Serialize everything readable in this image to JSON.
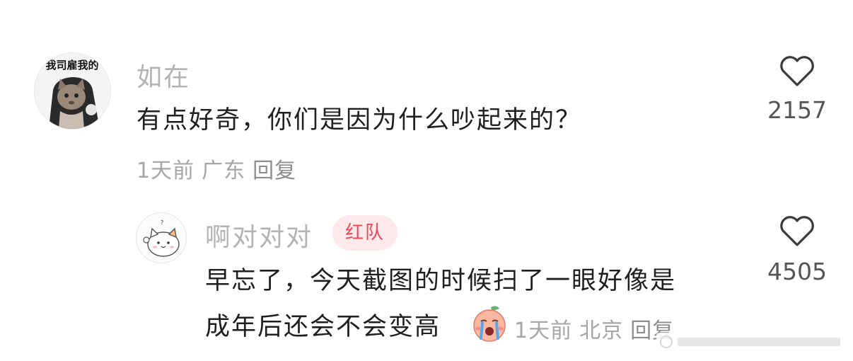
{
  "comment": {
    "username": "如在",
    "avatar_icon": "cat-meme-avatar",
    "avatar_text": "我司雇我的",
    "text": "有点好奇，你们是因为什么吵起来的？",
    "time": "1天前",
    "location": "广东",
    "reply_label": "回复",
    "like_count": "2157"
  },
  "reply": {
    "username": "啊对对对",
    "badge": "红队",
    "avatar_icon": "white-cat-avatar",
    "text_line1": "早忘了，今天截图的时候扫了一眼好像是",
    "text_line2": "成年后还会不会变高",
    "emoji_icon": "crying-peach-sticker",
    "time": "1天前",
    "location": "北京",
    "reply_label": "回复",
    "like_count": "4505"
  },
  "colors": {
    "username": "#b3b3b3",
    "badge_bg": "#fde9ea",
    "badge_text": "#e9495a",
    "meta": "#a6a6a6"
  }
}
